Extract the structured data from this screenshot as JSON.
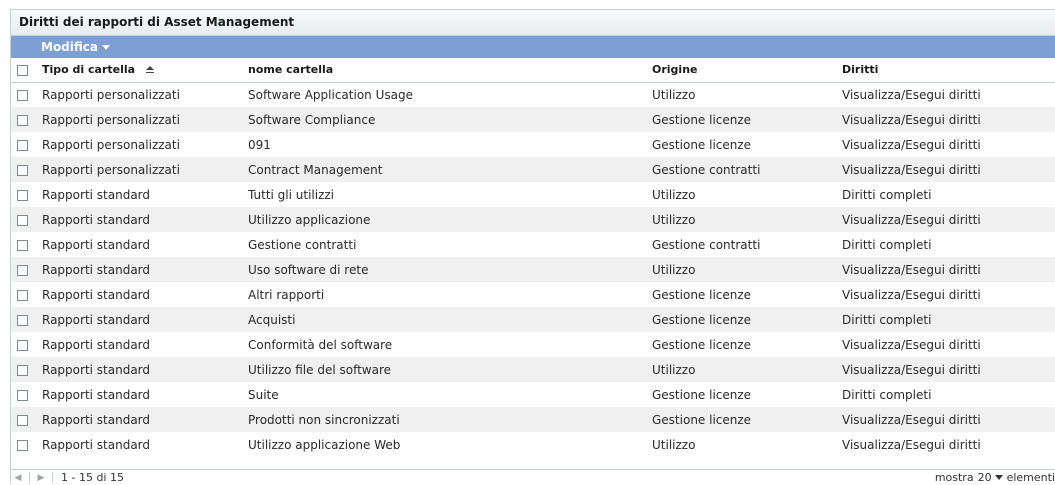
{
  "panel": {
    "title": "Diritti dei rapporti di Asset Management"
  },
  "toolbar": {
    "modify_label": "Modifica"
  },
  "table": {
    "columns": [
      "Tipo di cartella",
      "nome cartella",
      "Origine",
      "Diritti"
    ],
    "rows": [
      [
        "Rapporti personalizzati",
        "Software Application Usage",
        "Utilizzo",
        "Visualizza/Esegui diritti"
      ],
      [
        "Rapporti personalizzati",
        "Software Compliance",
        "Gestione licenze",
        "Visualizza/Esegui diritti"
      ],
      [
        "Rapporti personalizzati",
        "091",
        "Gestione licenze",
        "Visualizza/Esegui diritti"
      ],
      [
        "Rapporti personalizzati",
        "Contract Management",
        "Gestione contratti",
        "Visualizza/Esegui diritti"
      ],
      [
        "Rapporti standard",
        "Tutti gli utilizzi",
        "Utilizzo",
        "Diritti completi"
      ],
      [
        "Rapporti standard",
        "Utilizzo applicazione",
        "Utilizzo",
        "Visualizza/Esegui diritti"
      ],
      [
        "Rapporti standard",
        "Gestione contratti",
        "Gestione contratti",
        "Diritti completi"
      ],
      [
        "Rapporti standard",
        "Uso software di rete",
        "Utilizzo",
        "Visualizza/Esegui diritti"
      ],
      [
        "Rapporti standard",
        "Altri rapporti",
        "Gestione licenze",
        "Visualizza/Esegui diritti"
      ],
      [
        "Rapporti standard",
        "Acquisti",
        "Gestione licenze",
        "Diritti completi"
      ],
      [
        "Rapporti standard",
        "Conformità del software",
        "Gestione licenze",
        "Visualizza/Esegui diritti"
      ],
      [
        "Rapporti standard",
        "Utilizzo file del software",
        "Utilizzo",
        "Visualizza/Esegui diritti"
      ],
      [
        "Rapporti standard",
        "Suite",
        "Gestione licenze",
        "Diritti completi"
      ],
      [
        "Rapporti standard",
        "Prodotti non sincronizzati",
        "Gestione licenze",
        "Visualizza/Esegui diritti"
      ],
      [
        "Rapporti standard",
        "Utilizzo applicazione Web",
        "Utilizzo",
        "Visualizza/Esegui diritti"
      ]
    ]
  },
  "footer": {
    "range": "1 - 15 di 15",
    "show_label": "mostra",
    "page_size": "20",
    "items_label": "elementi"
  },
  "colors": {
    "toolbar": "#7d9fd3",
    "row_alt": "#f0f0f0"
  }
}
